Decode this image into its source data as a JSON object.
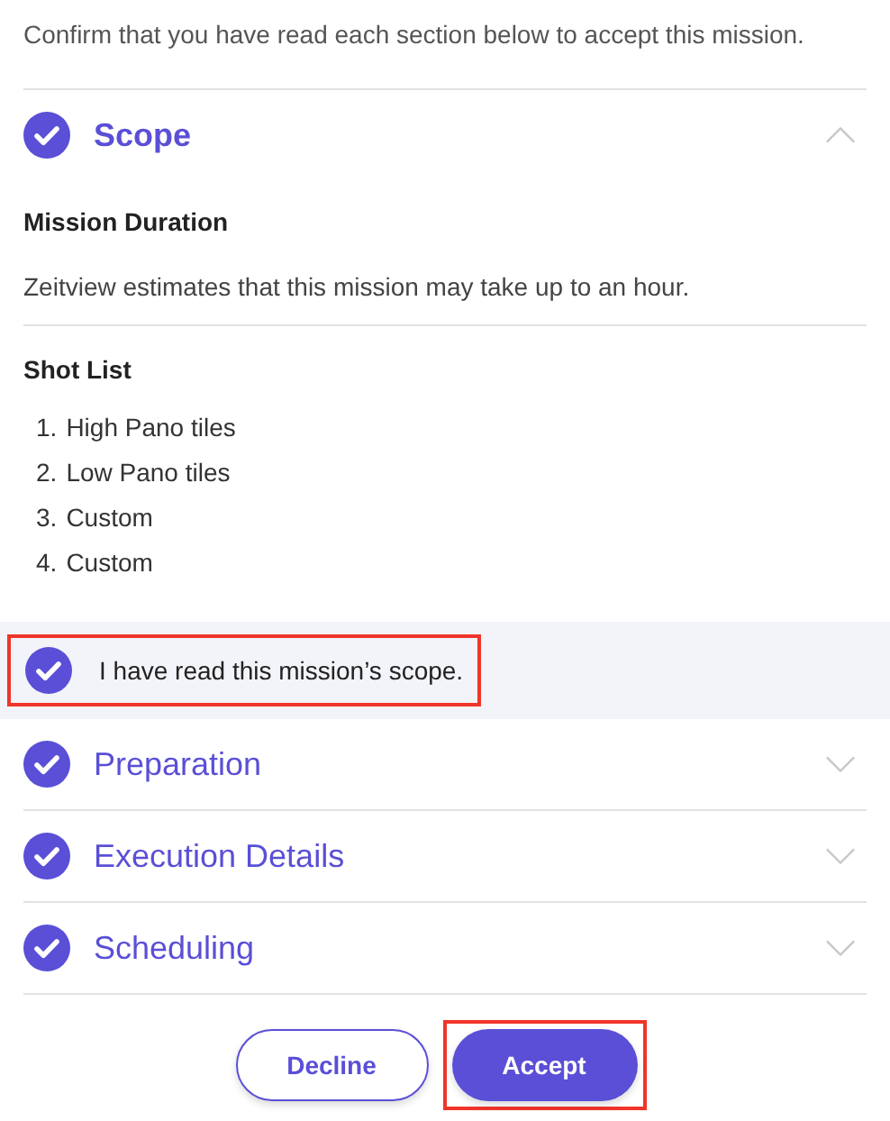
{
  "intro": "Confirm that you have read each section below to accept this mission.",
  "sections": [
    {
      "title": "Scope",
      "checked": true,
      "expanded": true,
      "duration": {
        "heading": "Mission Duration",
        "text": "Zeitview estimates that this mission may take up to an hour."
      },
      "shot_list": {
        "heading": "Shot List",
        "items": [
          {
            "number": "1.",
            "text": "High Pano tiles"
          },
          {
            "number": "2.",
            "text": "Low Pano tiles"
          },
          {
            "number": "3.",
            "text": "Custom"
          },
          {
            "number": "4.",
            "text": "Custom"
          }
        ]
      },
      "acknowledgement": {
        "label": "I have read this mission’s scope.",
        "checked": true,
        "highlighted": true
      }
    },
    {
      "title": "Preparation",
      "checked": true,
      "expanded": false
    },
    {
      "title": "Execution Details",
      "checked": true,
      "expanded": false
    },
    {
      "title": "Scheduling",
      "checked": true,
      "expanded": false
    }
  ],
  "buttons": [
    {
      "label": "Decline",
      "kind": "secondary",
      "highlighted": false
    },
    {
      "label": "Accept",
      "kind": "primary",
      "highlighted": true
    }
  ]
}
